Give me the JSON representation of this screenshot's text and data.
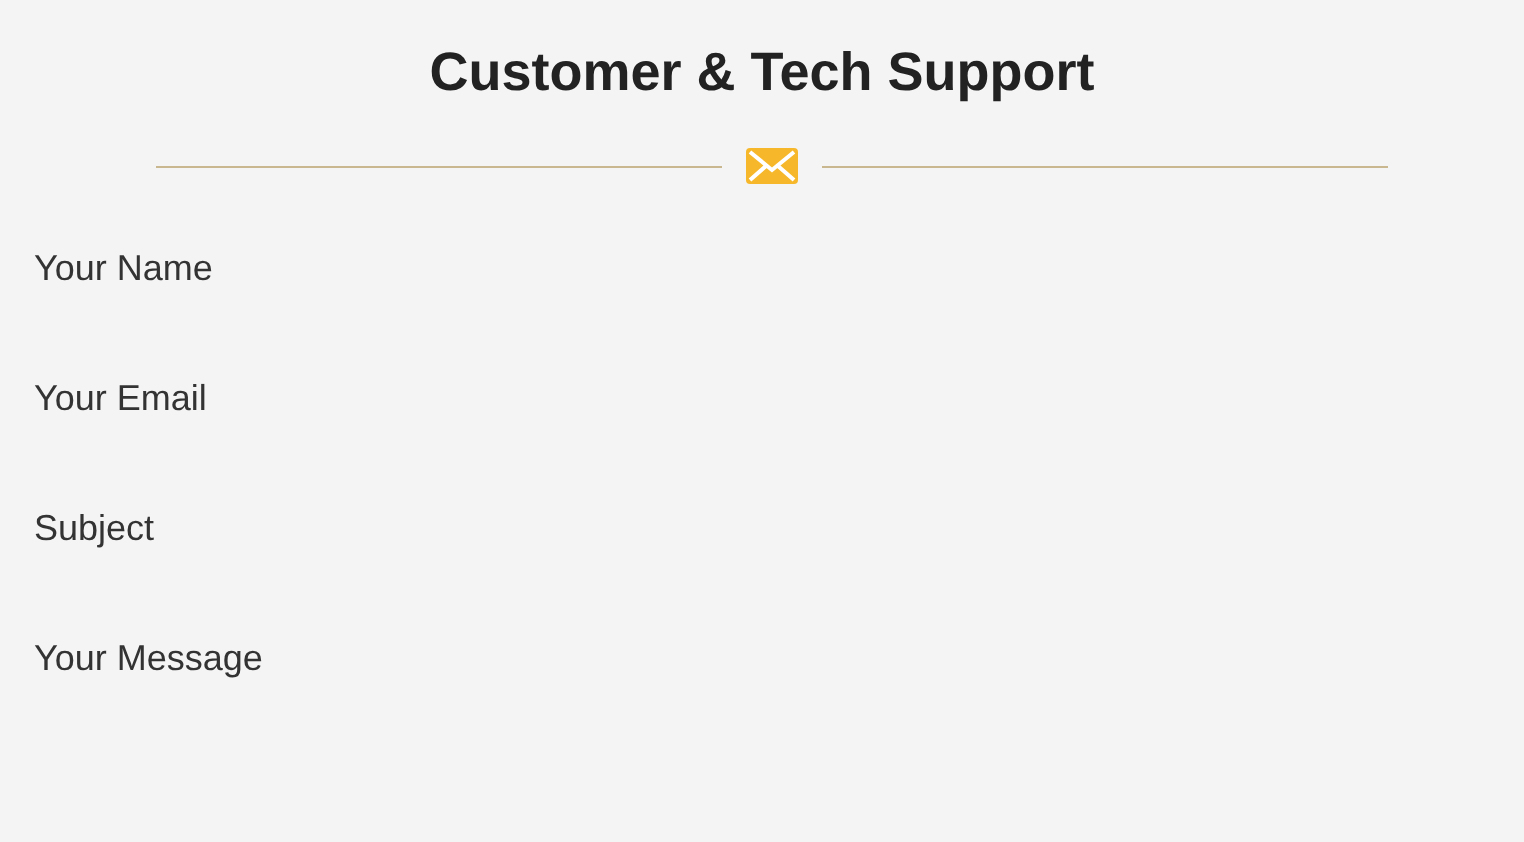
{
  "title": "Customer & Tech Support",
  "fields": [
    {
      "label": "Your Name"
    },
    {
      "label": "Your Email"
    },
    {
      "label": "Subject"
    },
    {
      "label": "Your Message"
    }
  ]
}
